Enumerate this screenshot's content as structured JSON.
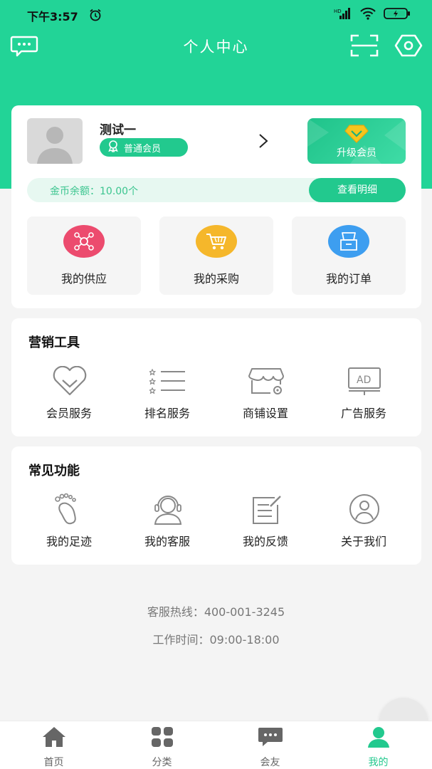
{
  "status": {
    "time": "下午3:57",
    "battery_charging": true
  },
  "nav": {
    "title": "个人中心",
    "left_icon": "message-icon",
    "right_icons": [
      "scan-icon",
      "settings-icon"
    ]
  },
  "profile": {
    "name": "测试一",
    "member_level": "普通会员",
    "upgrade_label": "升级会员",
    "coin_balance": "金币余额：10.00个",
    "coin_detail_label": "查看明细"
  },
  "quick_actions": [
    {
      "label": "我的供应",
      "icon": "supply-icon",
      "color": "#ec4b6e"
    },
    {
      "label": "我的采购",
      "icon": "cart-icon",
      "color": "#f5b72b"
    },
    {
      "label": "我的订单",
      "icon": "bag-icon",
      "color": "#3d9ef0"
    }
  ],
  "marketing": {
    "title": "营销工具",
    "items": [
      {
        "label": "会员服务",
        "icon": "heart-icon"
      },
      {
        "label": "排名服务",
        "icon": "ranking-list-icon"
      },
      {
        "label": "商铺设置",
        "icon": "store-icon"
      },
      {
        "label": "广告服务",
        "icon": "ad-icon"
      }
    ]
  },
  "common": {
    "title": "常见功能",
    "items": [
      {
        "label": "我的足迹",
        "icon": "footprint-icon"
      },
      {
        "label": "我的客服",
        "icon": "customer-service-icon"
      },
      {
        "label": "我的反馈",
        "icon": "feedback-icon"
      },
      {
        "label": "关于我们",
        "icon": "about-user-icon"
      }
    ]
  },
  "footer": {
    "hotline": "客服热线：400-001-3245",
    "hours": "工作时间：09:00-18:00"
  },
  "tabs": [
    {
      "label": "首页",
      "icon": "home-icon",
      "active": false
    },
    {
      "label": "分类",
      "icon": "category-icon",
      "active": false
    },
    {
      "label": "会友",
      "icon": "chat-icon",
      "active": false
    },
    {
      "label": "我的",
      "icon": "profile-icon",
      "active": true
    }
  ],
  "colors": {
    "primary": "#22d497",
    "accent": "#22c98e"
  }
}
